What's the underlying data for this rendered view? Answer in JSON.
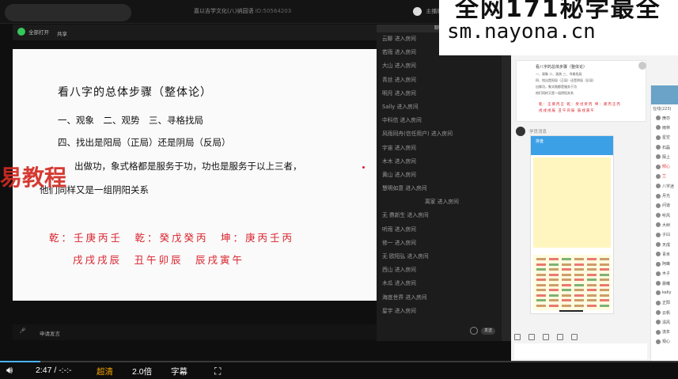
{
  "window": {
    "title": "嘉以吉学文化(八)纳园语",
    "room_id": "ID:50564203",
    "teacher": "主播昵称",
    "camera_label": "全部打开",
    "share_label": "共享"
  },
  "slide": {
    "heading": "看八字的总体步骤（整体论）",
    "line2": "一、观象　二、观势　三、寻格找局",
    "line3": "四、找出是阳局（正局）还是阴局（反局）",
    "line4": "出做功，象式格都是服务于功，功也是服务于以上三者，",
    "line5": "他们同样又是一组阴阳关系",
    "red_row1": "乾：壬庚丙壬　乾：癸戊癸丙　坤：庚丙壬丙",
    "red_row2": "戌戌戌辰　丑午卯辰　辰戌寅午"
  },
  "watermarks": {
    "left": "易教程",
    "top_line1": "全网171秘学最全",
    "top_line2": "sm.nayona.cn"
  },
  "inner_bottom": {
    "speaker": "申请发言"
  },
  "chat": {
    "header": "聊天",
    "entries": [
      "云聊 进入房间",
      "若雨 进入房间",
      "大山 进入房间",
      "青丝 进入房间",
      "明月 进入房间",
      "Sally 进入房间",
      "中科信 进入房间",
      "风雨同舟(信任用户) 进入房间",
      "宇宙 进入房间",
      "木木 进入房间",
      "黄山 进入房间",
      "慧明如意 进入房间",
      "离家 进入房间",
      "无 鼎新生 进入房间",
      "听雨 进入房间",
      "修一 进入房间",
      "无 欧阳弘 进入房间",
      "西山 进入房间",
      "木瓜 进入房间",
      "海底世界 进入房间",
      "星宇 进入房间"
    ],
    "send_label": "发送"
  },
  "right_panel": {
    "thumb_heading": "看八字的总体步骤（整体论）",
    "thumb_red": "乾：壬庚丙壬 乾：癸戊癸丙 坤：庚丙壬丙",
    "msg_user": "学员消息",
    "phone_title": "排盘",
    "user_count": "在线(223)",
    "users": [
      "庚亦",
      "雨林",
      "星空",
      "石磊",
      "陌上",
      "倾心",
      "兰",
      "八字迷",
      "月光",
      "问道",
      "听风",
      "大树",
      "子曰",
      "天成",
      "青禾",
      "阿峰",
      "木子",
      "晨曦",
      "kelly",
      "正阳",
      "云帆",
      "清风",
      "流年",
      "观心"
    ]
  },
  "player": {
    "time": "2:47 / -:-:-",
    "quality": "超清",
    "speed": "2.0倍",
    "subtitles": "字幕",
    "volume_icon": "speaker-icon",
    "fullscreen_icon": "fullscreen-icon",
    "progress_pct": 6,
    "accent": "#4ab4ff"
  }
}
